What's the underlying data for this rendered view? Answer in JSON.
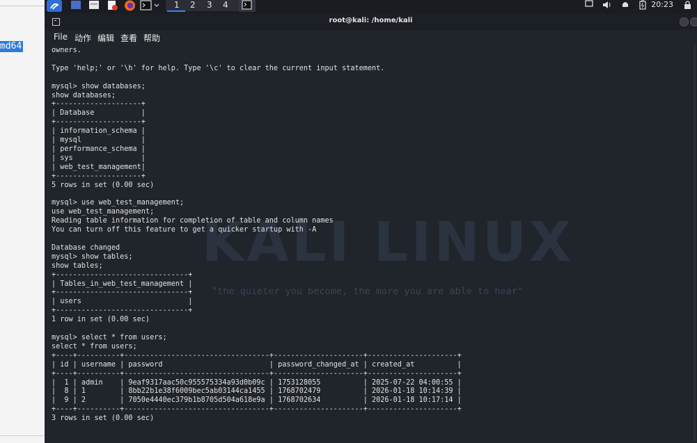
{
  "left_window": {
    "selected_text": "md64"
  },
  "panel": {
    "workspaces": [
      "1",
      "2",
      "3",
      "4"
    ],
    "clock": "20:23",
    "icons": [
      "kali-menu-icon",
      "desktop-icon",
      "file-manager-icon",
      "text-editor-icon",
      "firefox-icon",
      "terminal-icon",
      "volume-icon",
      "notification-bell-icon",
      "battery-icon",
      "lock-icon"
    ]
  },
  "terminal": {
    "title": "root@kali: /home/kali",
    "menu": [
      "File",
      "动作",
      "编辑",
      "查看",
      "帮助"
    ],
    "watermark": {
      "big": "KALI LINUX",
      "quote": "\"the quieter you become, the more you are able to hear\""
    },
    "lines": [
      "owners.",
      "",
      "Type 'help;' or '\\h' for help. Type '\\c' to clear the current input statement.",
      "",
      "mysql> show databases;",
      "show databases;",
      "+--------------------+",
      "| Database           |",
      "+--------------------+",
      "| information_schema |",
      "| mysql              |",
      "| performance_schema |",
      "| sys                |",
      "| web_test_management|",
      "+--------------------+",
      "5 rows in set (0.00 sec)",
      "",
      "mysql> use web_test_management;",
      "use web_test_management;",
      "Reading table information for completion of table and column names",
      "You can turn off this feature to get a quicker startup with -A",
      "",
      "Database changed",
      "mysql> show tables;",
      "show tables;",
      "+-------------------------------+",
      "| Tables_in_web_test_management |",
      "+-------------------------------+",
      "| users                         |",
      "+-------------------------------+",
      "1 row in set (0.00 sec)",
      "",
      "mysql> select * from users;",
      "select * from users;",
      "+----+----------+----------------------------------+---------------------+---------------------+",
      "| id | username | password                         | password_changed_at | created_at          |",
      "+----+----------+----------------------------------+---------------------+---------------------+",
      "|  1 | admin    | 9eaf9317aac50c955575334a93d0b09c | 1753128055          | 2025-07-22 04:00:55 |",
      "|  8 | 1        | 8bb22b1e38f6009bec5ab03144ca1455 | 1768702479          | 2026-01-18 10:14:39 |",
      "|  9 | 2        | 7050e4440ec379b1b8705d504a618e9a | 1768702634          | 2026-01-18 10:17:14 |",
      "+----+----------+----------------------------------+---------------------+---------------------+",
      "3 rows in set (0.00 sec)"
    ]
  }
}
